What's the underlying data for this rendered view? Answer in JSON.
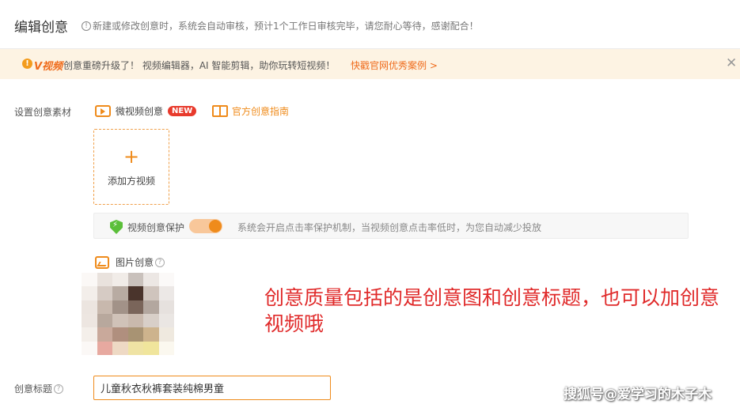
{
  "header": {
    "title": "编辑创意",
    "tip_icon": "info-icon",
    "tip": "新建或修改创意时，系统会自动审核，预计1个工作日审核完毕，请您耐心等待，感谢配合！"
  },
  "banner": {
    "logo_text": "V视频",
    "text": "创意重磅升级了！ 视频编辑器，AI 智能剪辑，助你玩转短视频！",
    "link": "快戳官网优秀案例 >",
    "close_icon": "close-icon",
    "background": "#fdf3e3",
    "accent": "#ef6b1b"
  },
  "material": {
    "label": "设置创意素材",
    "video_tab": "微视频创意",
    "new_badge": "NEW",
    "guide_link": "官方创意指南",
    "upload_plus": "+",
    "upload_label": "添加方视频"
  },
  "protection": {
    "label": "视频创意保护",
    "enabled": true,
    "description": "系统会开启点击率保护机制，当视频创意点击率低时，为您自动减少投放"
  },
  "image_creative": {
    "label": "图片创意"
  },
  "annotation": "创意质量包括的是创意图和创意标题，也可以加创意视频哦",
  "creative_title": {
    "label": "创意标题",
    "value": "儿童秋衣秋裤套装纯棉男童"
  },
  "watermark": "搜狐号@爱学习的木子木",
  "colors": {
    "accent": "#ef8b1b",
    "annotation": "#e02a2a",
    "badge": "#e83a2c",
    "shield": "#5bbf3a"
  }
}
